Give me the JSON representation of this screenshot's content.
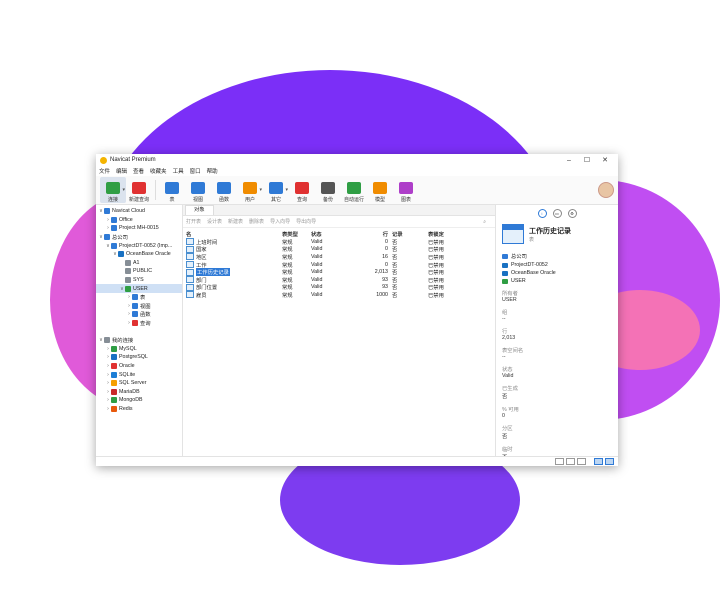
{
  "window": {
    "title": "Navicat Premium",
    "controls": [
      "–",
      "☐",
      "✕"
    ]
  },
  "menu": [
    "文件",
    "编辑",
    "查看",
    "收藏夹",
    "工具",
    "窗口",
    "帮助"
  ],
  "toolbar": [
    {
      "label": "连接",
      "icon": "connection-icon",
      "color": "#2f9e44",
      "active": true,
      "caret": true
    },
    {
      "label": "新建查询",
      "icon": "new-query-icon",
      "color": "#e03131"
    },
    {
      "sep": true
    },
    {
      "label": "表",
      "icon": "table-icon",
      "color": "#2f7ad6"
    },
    {
      "label": "视图",
      "icon": "view-icon",
      "color": "#2f7ad6"
    },
    {
      "label": "函数",
      "icon": "function-icon",
      "color": "#2f7ad6"
    },
    {
      "label": "用户",
      "icon": "user-icon",
      "color": "#f08c00",
      "caret": true
    },
    {
      "label": "其它",
      "icon": "other-icon",
      "color": "#2f7ad6",
      "caret": true
    },
    {
      "label": "查询",
      "icon": "query-icon",
      "color": "#e03131"
    },
    {
      "label": "备份",
      "icon": "backup-icon",
      "color": "#555555"
    },
    {
      "label": "自动运行",
      "icon": "automation-icon",
      "color": "#2f9e44"
    },
    {
      "label": "模型",
      "icon": "model-icon",
      "color": "#f08c00"
    },
    {
      "label": "图表",
      "icon": "chart-icon",
      "color": "#ae3ec9"
    }
  ],
  "sidebar": [
    {
      "label": "Navicat Cloud",
      "level": 0,
      "chev": "∨",
      "color": "#2f7ad6"
    },
    {
      "label": "Office",
      "level": 1,
      "chev": "›",
      "color": "#2f7ad6"
    },
    {
      "label": "Project MH-0015",
      "level": 1,
      "chev": "›",
      "color": "#2f7ad6"
    },
    {
      "label": "总公司",
      "level": 0,
      "chev": "∨",
      "color": "#2f7ad6"
    },
    {
      "label": "ProjectDT-0052 (Imp...",
      "level": 1,
      "chev": "∨",
      "color": "#2f7ad6"
    },
    {
      "label": "OceanBase Oracle",
      "level": 2,
      "chev": "∨",
      "color": "#1971c2"
    },
    {
      "label": "A1",
      "level": 3,
      "chev": "",
      "color": "#868e96"
    },
    {
      "label": "PUBLIC",
      "level": 3,
      "chev": "",
      "color": "#868e96"
    },
    {
      "label": "SYS",
      "level": 3,
      "chev": "",
      "color": "#868e96"
    },
    {
      "label": "USER",
      "level": 3,
      "chev": "∨",
      "color": "#2f9e44",
      "selected": true
    },
    {
      "label": "表",
      "level": 4,
      "chev": "›",
      "color": "#2f7ad6"
    },
    {
      "label": "视图",
      "level": 4,
      "chev": "›",
      "color": "#2f7ad6"
    },
    {
      "label": "函数",
      "level": 4,
      "chev": "›",
      "color": "#2f7ad6"
    },
    {
      "label": "查询",
      "level": 4,
      "chev": "›",
      "color": "#e03131"
    },
    {
      "label": "",
      "level": 0,
      "chev": "",
      "color": "transparent"
    },
    {
      "label": "我的连接",
      "level": 0,
      "chev": "∨",
      "color": "#868e96"
    },
    {
      "label": "MySQL",
      "level": 1,
      "chev": "›",
      "color": "#2f9e44"
    },
    {
      "label": "PostgreSQL",
      "level": 1,
      "chev": "›",
      "color": "#1971c2"
    },
    {
      "label": "Oracle",
      "level": 1,
      "chev": "›",
      "color": "#e03131"
    },
    {
      "label": "SQLite",
      "level": 1,
      "chev": "›",
      "color": "#1c7ed6"
    },
    {
      "label": "SQL Server",
      "level": 1,
      "chev": "›",
      "color": "#f59f00"
    },
    {
      "label": "MariaDB",
      "level": 1,
      "chev": "›",
      "color": "#c92a2a"
    },
    {
      "label": "MongoDB",
      "level": 1,
      "chev": "›",
      "color": "#2f9e44"
    },
    {
      "label": "Redis",
      "level": 1,
      "chev": "›",
      "color": "#e8590c"
    }
  ],
  "tab": "对象",
  "object_toolbar": [
    "打开表",
    "设计表",
    "新建表",
    "删除表",
    "导入向导",
    "导出向导"
  ],
  "table": {
    "headers": [
      "名",
      "表类型",
      "状态",
      "行",
      "记录",
      "表锁定"
    ],
    "rows": [
      {
        "name": "上班时间",
        "type": "常规",
        "status": "Valid",
        "rows": "0",
        "rec": "否",
        "ro": "已禁用"
      },
      {
        "name": "国家",
        "type": "常规",
        "status": "Valid",
        "rows": "0",
        "rec": "否",
        "ro": "已禁用"
      },
      {
        "name": "地区",
        "type": "常规",
        "status": "Valid",
        "rows": "16",
        "rec": "否",
        "ro": "已禁用"
      },
      {
        "name": "工作",
        "type": "常规",
        "status": "Valid",
        "rows": "0",
        "rec": "否",
        "ro": "已禁用"
      },
      {
        "name": "工作历史记录",
        "type": "常规",
        "status": "Valid",
        "rows": "2,013",
        "rec": "否",
        "ro": "已禁用",
        "selected": true
      },
      {
        "name": "部门",
        "type": "常规",
        "status": "Valid",
        "rows": "93",
        "rec": "否",
        "ro": "已禁用"
      },
      {
        "name": "部门位置",
        "type": "常规",
        "status": "Valid",
        "rows": "93",
        "rec": "否",
        "ro": "已禁用"
      },
      {
        "name": "雇员",
        "type": "常规",
        "status": "Valid",
        "rows": "1000",
        "rec": "否",
        "ro": "已禁用"
      }
    ]
  },
  "info": {
    "title": "工作历史记录",
    "subtitle": "表",
    "path": [
      {
        "text": "总公司",
        "color": "#2f7ad6"
      },
      {
        "text": "ProjectDT-0052",
        "color": "#1971c2"
      },
      {
        "text": "OceanBase Oracle",
        "color": "#1971c2"
      },
      {
        "text": "USER",
        "color": "#2f9e44"
      }
    ],
    "fields": [
      {
        "label": "所有者",
        "value": "USER"
      },
      {
        "label": "组",
        "value": "--"
      },
      {
        "label": "行",
        "value": "2,013"
      },
      {
        "label": "表空间名",
        "value": "--"
      },
      {
        "label": "状态",
        "value": "Valid"
      },
      {
        "label": "已生成",
        "value": "否"
      },
      {
        "label": "% 可用",
        "value": "0"
      },
      {
        "label": "分区",
        "value": "否"
      },
      {
        "label": "临时",
        "value": "否"
      }
    ]
  }
}
